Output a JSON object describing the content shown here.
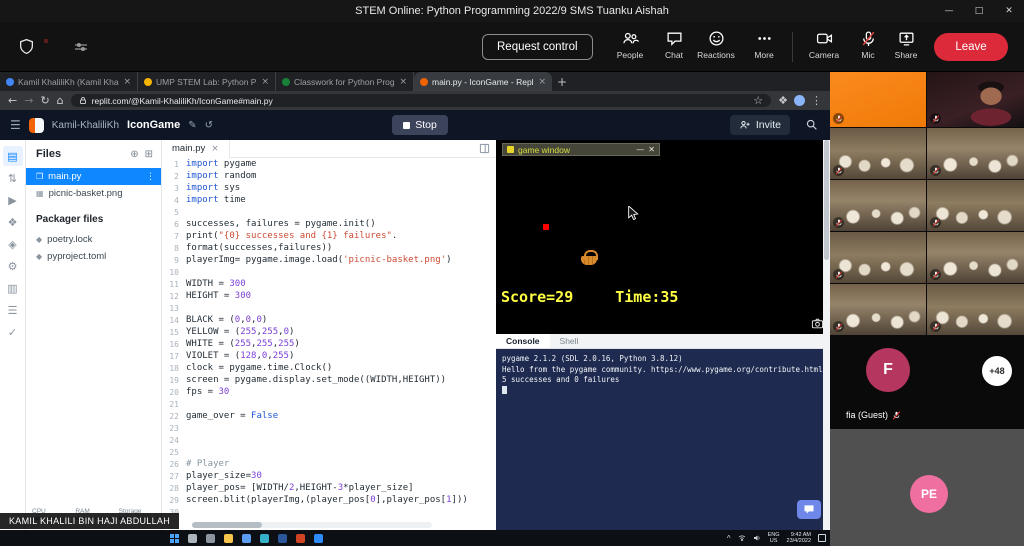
{
  "window": {
    "title": "STEM Online: Python Programming 2022/9 SMS Tuanku Aishah",
    "controls": {
      "minimize": "—",
      "maximize": "□",
      "close": "✕"
    }
  },
  "zoom": {
    "request_control": "Request control",
    "menu": [
      {
        "id": "people",
        "label": "People"
      },
      {
        "id": "chat",
        "label": "Chat"
      },
      {
        "id": "reactions",
        "label": "Reactions"
      },
      {
        "id": "more",
        "label": "More"
      }
    ],
    "av": [
      {
        "id": "camera",
        "label": "Camera"
      },
      {
        "id": "mic",
        "label": "Mic"
      },
      {
        "id": "share",
        "label": "Share"
      }
    ],
    "leave_label": "Leave"
  },
  "browser": {
    "tabs": [
      {
        "title": "Kamil KhaliliKh (Kamil Khalili Kh",
        "favicon": "#4285f4",
        "active": false
      },
      {
        "title": "UMP STEM Lab: Python Progra",
        "favicon": "#f4b400",
        "active": false
      },
      {
        "title": "Classwork for Python Programm",
        "favicon": "#188038",
        "active": false
      },
      {
        "title": "main.py - IconGame - Replit",
        "favicon": "#f26207",
        "active": true
      }
    ],
    "url": "replit.com/@Kamil-KhaliliKh/IconGame#main.py"
  },
  "replit": {
    "user": "Kamil-KhaliliKh",
    "repl": "IconGame",
    "stop_label": "Stop",
    "invite_label": "Invite",
    "rail": [
      {
        "name": "files",
        "glyph": "▤",
        "active": true
      },
      {
        "name": "version-control",
        "glyph": "⇅",
        "active": false
      },
      {
        "name": "run",
        "glyph": "▶",
        "active": false
      },
      {
        "name": "packages",
        "glyph": "❖",
        "active": false
      },
      {
        "name": "secrets",
        "glyph": "◈",
        "active": false
      },
      {
        "name": "settings",
        "glyph": "⚙",
        "active": false
      },
      {
        "name": "database",
        "glyph": "▥",
        "active": false
      },
      {
        "name": "docs",
        "glyph": "☰",
        "active": false
      },
      {
        "name": "checks",
        "glyph": "✓",
        "active": false
      }
    ],
    "files_header": "Files",
    "files": [
      {
        "name": "main.py",
        "icon": "file",
        "selected": true
      },
      {
        "name": "picnic-basket.png",
        "icon": "image",
        "selected": false
      }
    ],
    "packager_header": "Packager files",
    "packager_files": [
      "poetry.lock",
      "pyproject.toml"
    ],
    "meters": [
      "CPU",
      "RAM",
      "Storage"
    ],
    "editor_tab": "main.py",
    "code": [
      "import pygame",
      "import random",
      "import sys",
      "import time",
      "",
      "successes, failures = pygame.init()",
      "print(\"{0} successes and {1} failures\".",
      "format(successes,failures))",
      "playerImg= pygame.image.load('picnic-basket.png')",
      "",
      "WIDTH = 300",
      "HEIGHT = 300",
      "",
      "BLACK = (0,0,0)",
      "YELLOW = (255,255,0)",
      "WHITE = (255,255,255)",
      "VIOLET = (128,0,255)",
      "clock = pygame.time.Clock()",
      "screen = pygame.display.set_mode((WIDTH,HEIGHT))",
      "fps = 30",
      "",
      "game_over = False",
      "",
      "",
      "",
      "# Player",
      "player_size=30",
      "player_pos= [WIDTH/2,HEIGHT-3*player_size]",
      "screen.blit(playerImg,(player_pos[0],player_pos[1]))",
      ""
    ],
    "output": {
      "title": "game window",
      "score": "Score=29",
      "time": "Time:35"
    },
    "console": {
      "tabs": [
        "Console",
        "Shell"
      ],
      "lines": [
        "pygame 2.1.2 (SDL 2.0.16, Python 3.8.12)",
        "Hello from the pygame community. https://www.pygame.org/contribute.html",
        "5 successes and 0 failures"
      ]
    }
  },
  "participants": {
    "tiles": [
      "orange",
      "host",
      "c1",
      "c2",
      "c2",
      "c1",
      "c1",
      "c2",
      "c2",
      "c1"
    ],
    "name_label": "fia (Guest)",
    "overflow": "+48",
    "avatar_f": "F",
    "avatar_pe": "PE"
  },
  "overlay_name": "KAMIL KHALILI BIN HAJI ABDULLAH",
  "taskbar": {
    "icons": [
      {
        "name": "start",
        "color": "#4aa3ff"
      },
      {
        "name": "search",
        "color": "#aeb6bd"
      },
      {
        "name": "task-view",
        "color": "#8d969e"
      },
      {
        "name": "file-explorer",
        "color": "#f8c64a"
      },
      {
        "name": "chrome",
        "color": "#5a9df2"
      },
      {
        "name": "edge",
        "color": "#35b2c9"
      },
      {
        "name": "word",
        "color": "#2b579a"
      },
      {
        "name": "powerpoint",
        "color": "#d04423"
      },
      {
        "name": "zoom",
        "color": "#2d8cff"
      }
    ],
    "lang": "ENG",
    "layout": "US",
    "time": "9:42 AM",
    "date": "23/4/2022"
  },
  "colors": {
    "leave_red": "#dd2a3a",
    "selected_file_blue": "#0f87ff",
    "score_yellow": "#ffff43",
    "console_navy": "#1e2a4f",
    "orange_tile": "#f58220"
  }
}
